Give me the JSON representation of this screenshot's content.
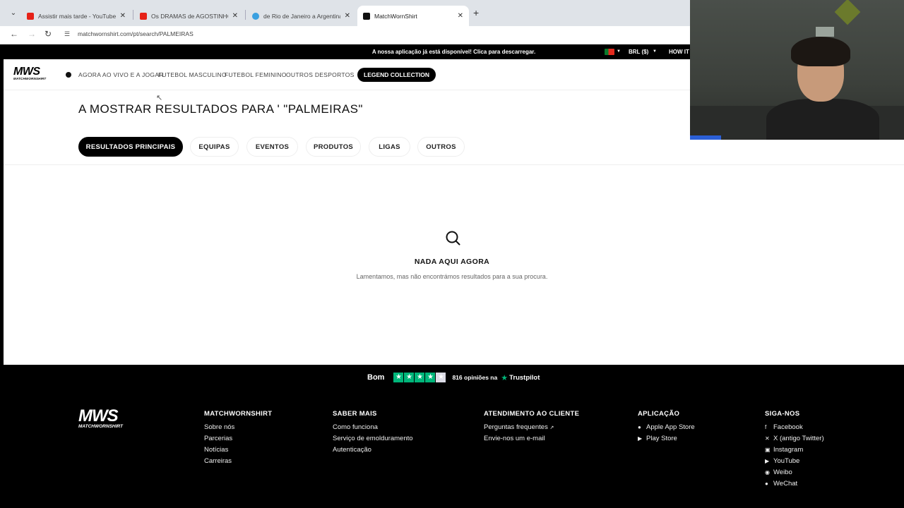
{
  "browser": {
    "tabs": [
      {
        "title": "Assistir mais tarde - YouTube",
        "icon": "youtube-icon",
        "color": "#e62117"
      },
      {
        "title": "Os DRAMAS de AGOSTINHO C",
        "icon": "youtube-icon",
        "color": "#e62117"
      },
      {
        "title": "de Rio de Janeiro a Argentina |",
        "icon": "globe-icon",
        "color": "#3aa0e0"
      },
      {
        "title": "MatchWornShirt",
        "icon": "mws-icon",
        "color": "#111111"
      }
    ],
    "url": "matchwornshirt.com/pt/search/PALMEIRAS"
  },
  "announcement": {
    "message": "A nossa aplicação já está disponível! Clica para descarregar.",
    "currency": "BRL  ($)",
    "how_it": "HOW IT W"
  },
  "header": {
    "logo_big": "MWS",
    "logo_small": "MATCHWORNSHIRT",
    "nav": [
      "AGORA AO VIVO E A JOGAR",
      "FUTEBOL MASCULINO",
      "FUTEBOL FEMININO",
      "OUTROS DESPORTOS"
    ],
    "legend_button": "LEGEND COLLECTION"
  },
  "search": {
    "title": "A MOSTRAR RESULTADOS PARA ' \"PALMEIRAS\"",
    "tabs": [
      "RESULTADOS PRINCIPAIS",
      "EQUIPAS",
      "EVENTOS",
      "PRODUTOS",
      "LIGAS",
      "OUTROS"
    ],
    "active_tab": "RESULTADOS PRINCIPAIS",
    "empty_title": "NADA AQUI AGORA",
    "empty_sub": "Lamentamos, mas não encontrámos resultados para a sua procura."
  },
  "footer": {
    "trust": {
      "word": "Bom",
      "rating_stars": 4,
      "count_text": "816 opiniões na",
      "brand": "Trustpilot"
    },
    "logo_big": "MWS",
    "logo_small": "MATCHWORNSHIRT",
    "columns": [
      {
        "heading": "MATCHWORNSHIRT",
        "items": [
          "Sobre nós",
          "Parcerias",
          "Notícias",
          "Carreiras"
        ]
      },
      {
        "heading": "SABER MAIS",
        "items": [
          "Como funciona",
          "Serviço de emolduramento",
          "Autenticação"
        ]
      },
      {
        "heading": "ATENDIMENTO AO CLIENTE",
        "items": [
          "Perguntas frequentes",
          "Envie-nos um e-mail"
        ]
      },
      {
        "heading": "APLICAÇÃO",
        "items": [
          "Apple App Store",
          "Play Store"
        ]
      },
      {
        "heading": "SIGA-NOS",
        "items": [
          "Facebook",
          "X (antigo Twitter)",
          "Instagram",
          "YouTube",
          "Weibo",
          "WeChat"
        ]
      }
    ]
  },
  "colors": {
    "trustpilot_green": "#00b67a",
    "black": "#000000"
  }
}
